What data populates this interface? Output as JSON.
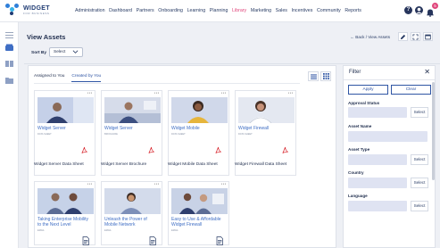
{
  "brand": {
    "name": "WIDGET",
    "tagline": "FOR BUSINESS"
  },
  "nav": [
    {
      "label": "Administration",
      "active": false
    },
    {
      "label": "Dashboard",
      "active": false
    },
    {
      "label": "Partners",
      "active": false
    },
    {
      "label": "Onboarding",
      "active": false
    },
    {
      "label": "Learning",
      "active": false
    },
    {
      "label": "Planning",
      "active": false
    },
    {
      "label": "Library",
      "active": true
    },
    {
      "label": "Marketing",
      "active": false
    },
    {
      "label": "Sales",
      "active": false
    },
    {
      "label": "Incentives",
      "active": false
    },
    {
      "label": "Community",
      "active": false
    },
    {
      "label": "Reports",
      "active": false
    }
  ],
  "topbar": {
    "help_icon": "?",
    "notification_count": "5"
  },
  "page": {
    "title": "View Assets",
    "back_link": "Back / View Assets"
  },
  "sort": {
    "label": "Sort By",
    "value": "Select"
  },
  "tabs": [
    {
      "label": "Assigned to You",
      "active": false
    },
    {
      "label": "Created by You",
      "active": true
    }
  ],
  "cards": [
    {
      "title": "Widget Server",
      "sub": "DATA SHEET",
      "footer": "Widget Server Data Sheet",
      "icon": "pdf-icon"
    },
    {
      "title": "Widget Server",
      "sub": "BROCHURE",
      "footer": "Widget Server Brochure",
      "icon": "pdf-icon"
    },
    {
      "title": "Widget Mobile",
      "sub": "DATA SHEET",
      "footer": "Widget Mobile Data Sheet",
      "icon": "pdf-icon"
    },
    {
      "title": "Widget Firewall",
      "sub": "DATA SHEET",
      "footer": "Widget Firewall Data Sheet",
      "icon": "pdf-icon"
    },
    {
      "title": "Taking Enterprise Mobility to the Next Level",
      "sub": "EMAIL",
      "footer": "",
      "icon": "doc-icon"
    },
    {
      "title": "Unleash the Power of Mobile Network",
      "sub": "EMAIL",
      "footer": "",
      "icon": "doc-icon"
    },
    {
      "title": "Easy to Use & Affordable Widget Firewall",
      "sub": "EMAIL",
      "footer": "",
      "icon": "doc-icon"
    }
  ],
  "filter": {
    "title": "Filter",
    "apply_label": "Apply",
    "clear_label": "Clear",
    "select_label": "Select",
    "fields": [
      "Approval Status",
      "Asset Name",
      "Asset Type",
      "Country",
      "Language"
    ]
  },
  "colors": {
    "accent": "#e0467c",
    "primary": "#2f55a4",
    "link": "#3f6ec4",
    "input_fill": "#dfe3f2"
  }
}
